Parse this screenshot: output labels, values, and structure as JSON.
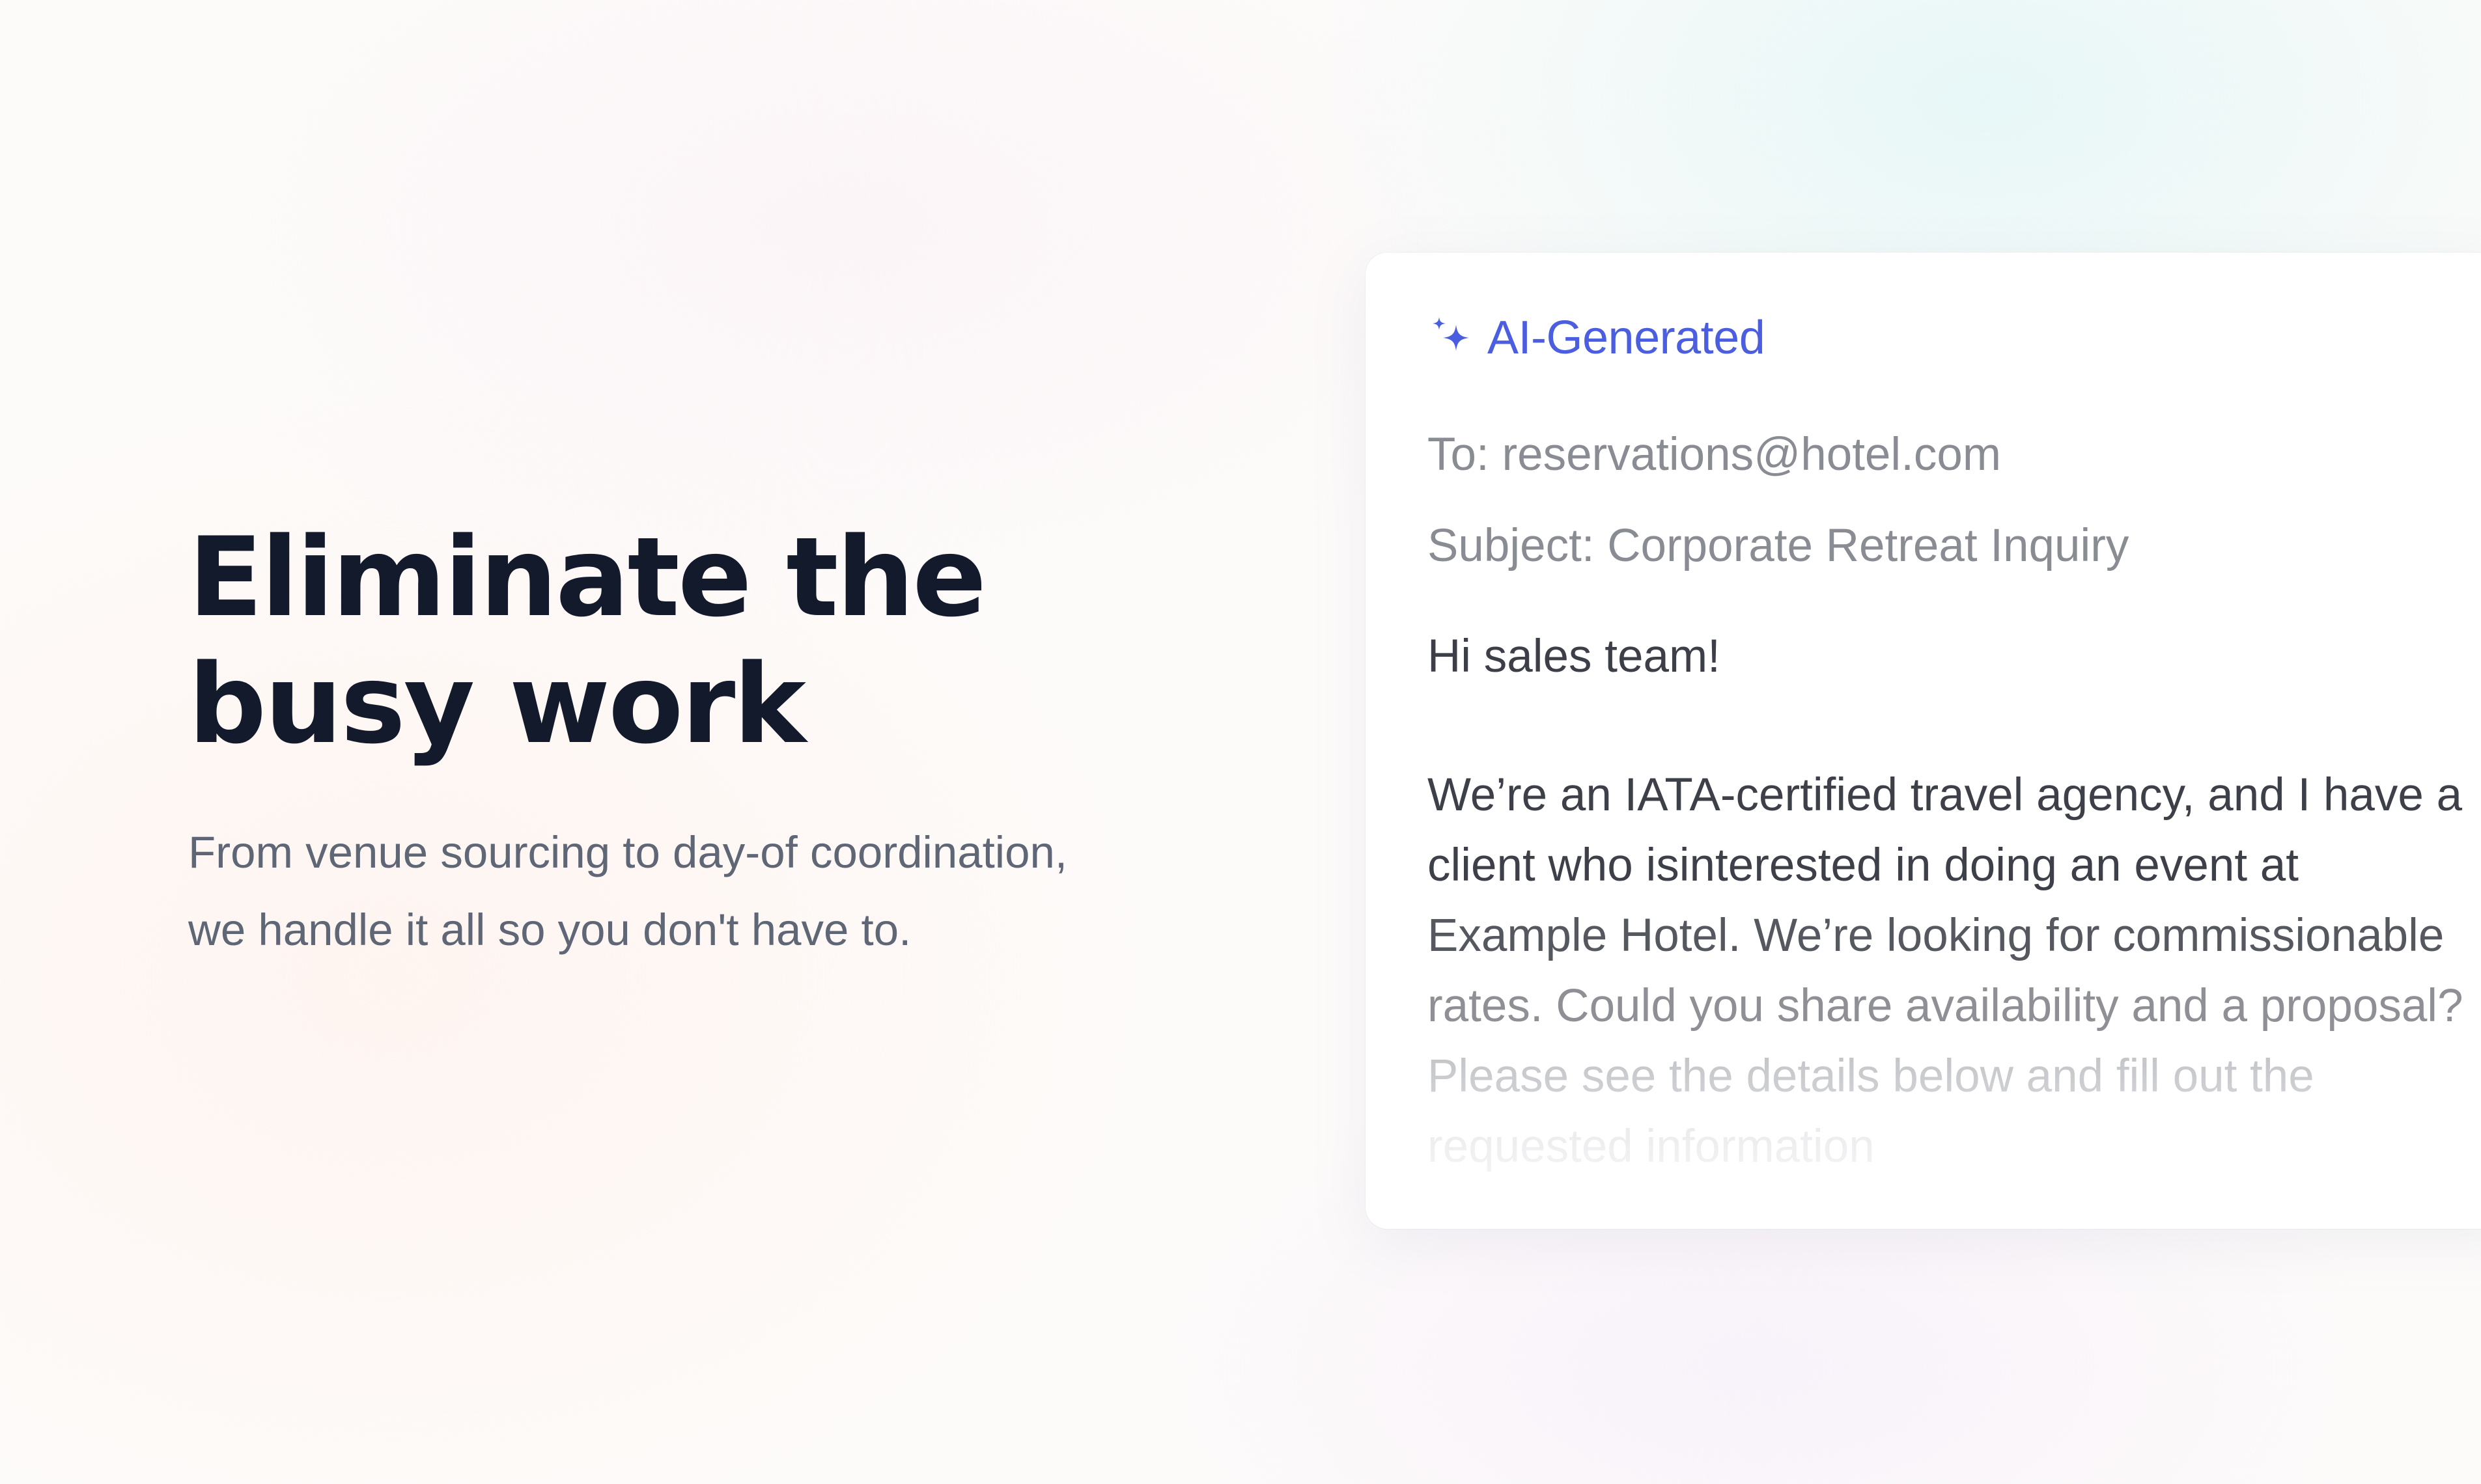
{
  "hero": {
    "title_lines": [
      "Eliminate the",
      "busy work"
    ],
    "subtitle_lines": [
      "From venue sourcing to day-of coordination,",
      "we handle it all so you don't have to."
    ]
  },
  "email_card": {
    "badge": {
      "icon": "sparkles-icon",
      "label": "AI-Generated",
      "color": "#4c5ee0"
    },
    "to": "To: reservations@hotel.com",
    "subject": "Subject: Corporate Retreat Inquiry",
    "greeting": "Hi sales team!",
    "body_lines": [
      "We’re an IATA-certified travel agency, and I have a",
      "client who isinterested in doing an event at",
      "Example Hotel. We’re looking for commissionable",
      "rates. Could you share availability and a proposal?",
      "Please see the details below and fill out the",
      "requested information"
    ]
  },
  "colors": {
    "heading": "#131a2c",
    "subtitle": "#5f6675",
    "accent": "#4c5ee0",
    "muted": "#8a8c93"
  }
}
